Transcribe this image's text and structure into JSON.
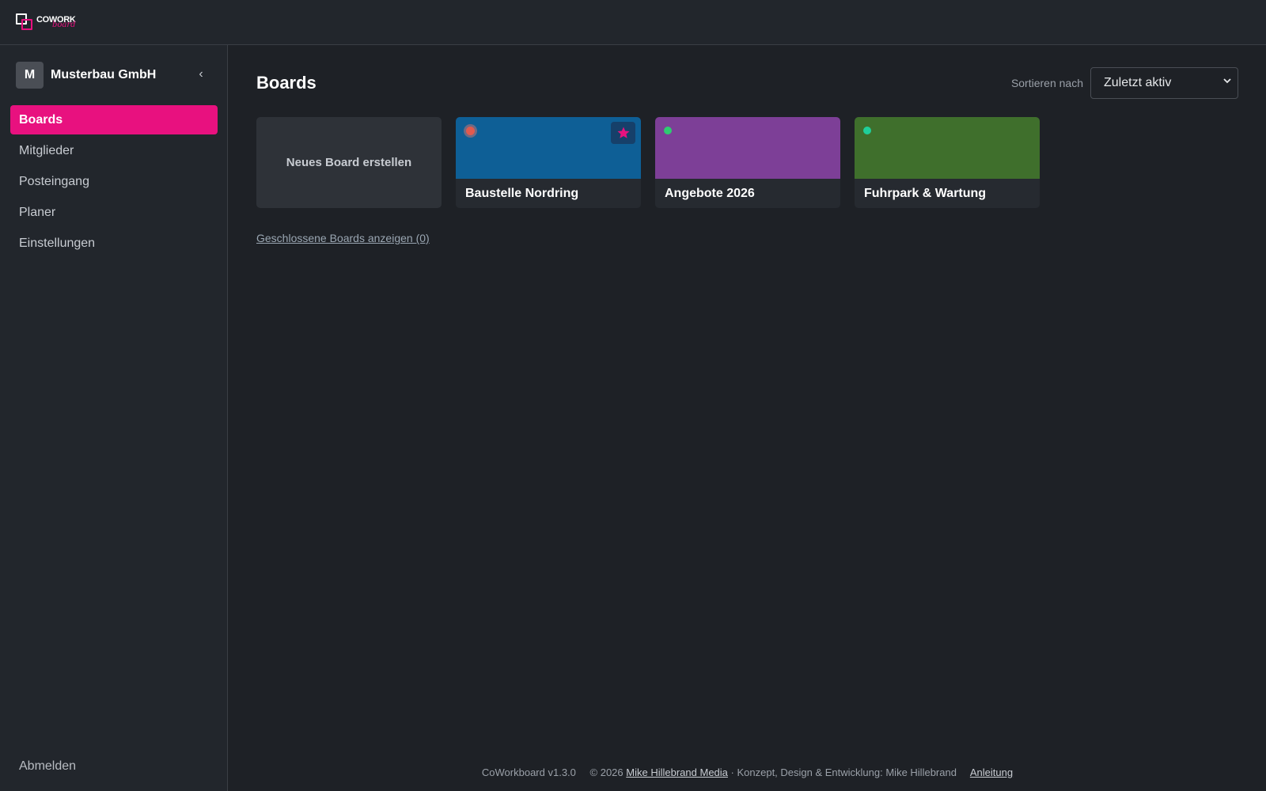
{
  "app": {
    "logo_text": "COWORK",
    "logo_sub": "board"
  },
  "sidebar": {
    "org_initial": "M",
    "org_name": "Musterbau GmbH",
    "collapse_glyph": "‹",
    "items": [
      {
        "label": "Boards",
        "active": true
      },
      {
        "label": "Mitglieder",
        "active": false
      },
      {
        "label": "Posteingang",
        "active": false
      },
      {
        "label": "Planer",
        "active": false
      },
      {
        "label": "Einstellungen",
        "active": false
      }
    ],
    "logout_label": "Abmelden"
  },
  "main": {
    "title": "Boards",
    "sort_label": "Sortieren nach",
    "sort_value": "Zuletzt aktiv",
    "new_board_label": "Neues Board erstellen",
    "boards": [
      {
        "name": "Baustelle Nordring",
        "color": "#0e5f96",
        "status_color": "#e05a4f",
        "favorite": true
      },
      {
        "name": "Angebote 2026",
        "color": "#7d3f97",
        "status_color": "#2ecc71",
        "favorite": false
      },
      {
        "name": "Fuhrpark & Wartung",
        "color": "#3f6f2c",
        "status_color": "#1fcf9a",
        "favorite": false
      }
    ],
    "closed_boards_link": "Geschlossene Boards anzeigen (0)"
  },
  "footer": {
    "version": "CoWorkboard v1.3.0",
    "copyright_prefix": "© 2026",
    "company_link": "Mike Hillebrand Media",
    "credits": "· Konzept, Design & Entwicklung: Mike Hillebrand",
    "guide_link": "Anleitung"
  },
  "colors": {
    "accent": "#e8117f",
    "background": "#1e2126",
    "sidebar": "#22262c"
  }
}
